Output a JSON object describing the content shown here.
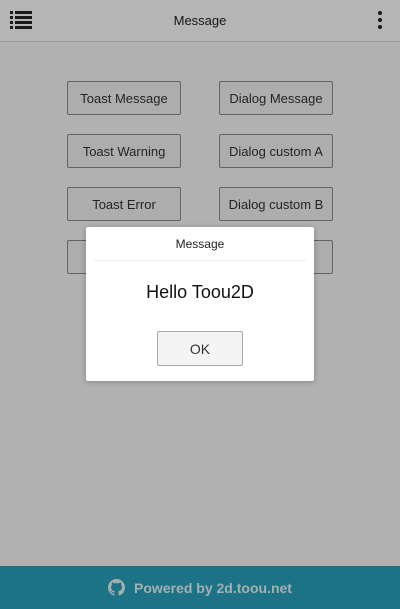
{
  "header": {
    "title": "Message",
    "menu_icon": "list-menu-icon",
    "more_icon": "more-vertical-icon"
  },
  "buttons": [
    {
      "label": "Toast Message"
    },
    {
      "label": "Dialog Message"
    },
    {
      "label": "Toast Warning"
    },
    {
      "label": "Dialog custom A"
    },
    {
      "label": "Toast Error"
    },
    {
      "label": "Dialog custom B"
    },
    {
      "label": ""
    },
    {
      "label": ""
    }
  ],
  "dialog": {
    "title": "Message",
    "message": "Hello Toou2D",
    "ok_label": "OK"
  },
  "footer": {
    "icon": "github-icon",
    "text": "Powered by 2d.toou.net"
  },
  "colors": {
    "footer_bg": "#27a3bc",
    "overlay": "rgba(0,0,0,0.29)",
    "button_border": "#8a8a8a"
  }
}
